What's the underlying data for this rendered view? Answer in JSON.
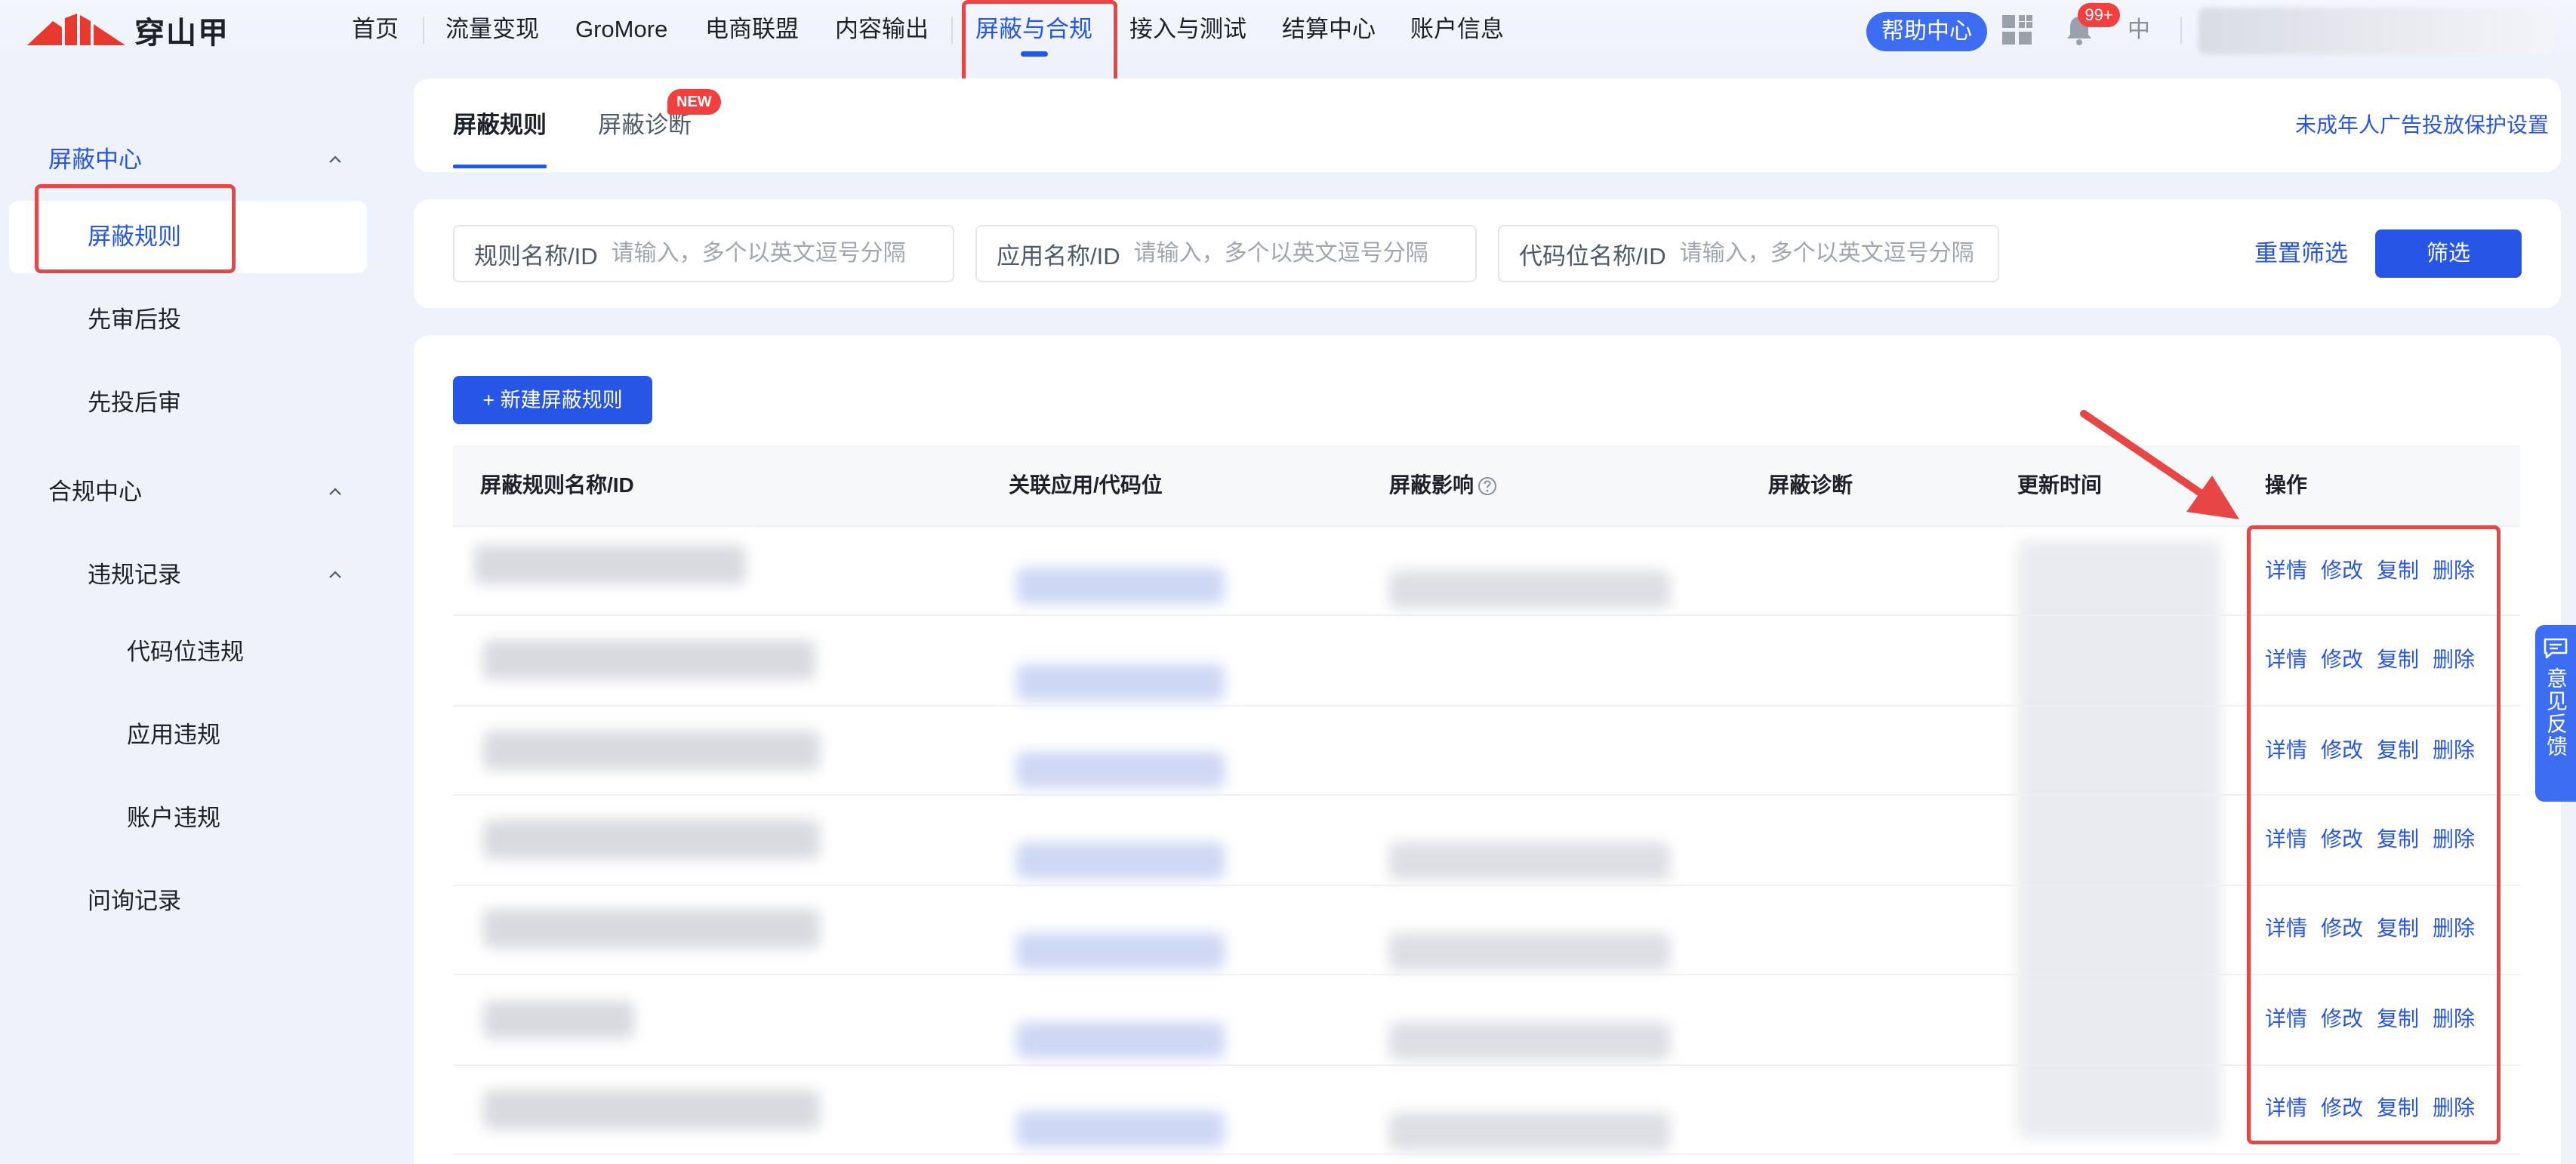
{
  "brand": {
    "name": "穿山甲",
    "logo_color": "#e8382f"
  },
  "topnav": {
    "items": [
      {
        "label": "首页"
      },
      {
        "label": "流量变现"
      },
      {
        "label": "GroMore"
      },
      {
        "label": "电商联盟"
      },
      {
        "label": "内容输出"
      },
      {
        "label": "屏蔽与合规",
        "active": true
      },
      {
        "label": "接入与测试"
      },
      {
        "label": "结算中心"
      },
      {
        "label": "账户信息"
      }
    ],
    "help_center": "帮助中心",
    "notification_badge": "99+",
    "language": "中",
    "icons": [
      "apps-grid-icon",
      "bell-icon"
    ]
  },
  "sidebar": {
    "groups": [
      {
        "label": "屏蔽中心",
        "expanded": true,
        "children": [
          {
            "label": "屏蔽规则",
            "selected": true
          },
          {
            "label": "先审后投"
          },
          {
            "label": "先投后审"
          }
        ]
      },
      {
        "label": "合规中心",
        "expanded": true,
        "children": [
          {
            "label": "违规记录",
            "expanded": true,
            "children": [
              {
                "label": "代码位违规"
              },
              {
                "label": "应用违规"
              },
              {
                "label": "账户违规"
              }
            ]
          },
          {
            "label": "问询记录"
          }
        ]
      }
    ]
  },
  "tabs": {
    "items": [
      {
        "label": "屏蔽规则",
        "active": true
      },
      {
        "label": "屏蔽诊断",
        "badge": "NEW"
      }
    ],
    "right_link": "未成年人广告投放保护设置"
  },
  "filters": {
    "fields": [
      {
        "label": "规则名称/ID",
        "placeholder": "请输入，多个以英文逗号分隔"
      },
      {
        "label": "应用名称/ID",
        "placeholder": "请输入，多个以英文逗号分隔"
      },
      {
        "label": "代码位名称/ID",
        "placeholder": "请输入，多个以英文逗号分隔"
      }
    ],
    "reset_label": "重置筛选",
    "submit_label": "筛选"
  },
  "table": {
    "create_button": "+ 新建屏蔽规则",
    "columns": [
      "屏蔽规则名称/ID",
      "关联应用/代码位",
      "屏蔽影响",
      "屏蔽诊断",
      "更新时间",
      "操作"
    ],
    "help_icon": "question-circle-icon",
    "row_actions": [
      "详情",
      "修改",
      "复制",
      "删除"
    ],
    "row_count": 7,
    "rows_content_blurred": true
  },
  "feedback": {
    "label": "意见反馈",
    "icon": "message-icon"
  },
  "colors": {
    "accent": "#2755e6",
    "highlight": "#e84545",
    "badge": "#f53f3f"
  }
}
